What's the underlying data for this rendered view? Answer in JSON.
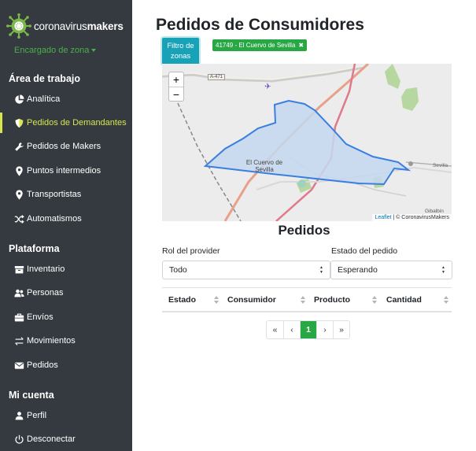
{
  "app": {
    "logo_prefix": "coronavirus",
    "logo_bold": "makers",
    "role_label": "Encargado de zona"
  },
  "sidebar": {
    "sections": [
      {
        "title": "Área de trabajo",
        "items": [
          {
            "label": "Analítica",
            "icon": "pie-chart-icon"
          },
          {
            "label": "Pedidos de Demandantes",
            "icon": "shield-icon",
            "active": true
          },
          {
            "label": "Pedidos de Makers",
            "icon": "wrench-icon"
          },
          {
            "label": "Puntos intermedios",
            "icon": "map-marker-icon"
          },
          {
            "label": "Transportistas",
            "icon": "map-marker-icon"
          },
          {
            "label": "Automatismos",
            "icon": "shuffle-icon"
          }
        ]
      },
      {
        "title": "Plataforma",
        "items": [
          {
            "label": "Inventario",
            "icon": "archive-icon"
          },
          {
            "label": "Personas",
            "icon": "users-icon"
          },
          {
            "label": "Envíos",
            "icon": "briefcase-icon"
          },
          {
            "label": "Movimientos",
            "icon": "exchange-icon"
          },
          {
            "label": "Pedidos",
            "icon": "envelope-icon"
          }
        ]
      },
      {
        "title": "Mi cuenta",
        "items": [
          {
            "label": "Perfil",
            "icon": "user-icon"
          },
          {
            "label": "Desconectar",
            "icon": "power-icon"
          }
        ]
      }
    ]
  },
  "main": {
    "title": "Pedidos de Consumidores",
    "filter_button": "Filtro de zonas",
    "filter_chip": "41749 - El Cuervo de Sevilla",
    "filter_chip_close": "✖",
    "map": {
      "zoom_in": "+",
      "zoom_out": "−",
      "town_label": "El Cuervo de Sevilla",
      "road_label": "A-471",
      "sevilla_label": "Sevilla",
      "gibalbin_label": "Gibalbin",
      "attribution_link": "Leaflet",
      "attribution_text": " | © CoronavirusMakers"
    },
    "orders_title": "Pedidos",
    "filters": {
      "provider_label": "Rol del provider",
      "provider_value": "Todo",
      "status_label": "Estado del pedido",
      "status_value": "Esperando"
    },
    "table": {
      "columns": [
        "Estado",
        "Consumidor",
        "Producto",
        "Cantidad"
      ],
      "rows": []
    },
    "pagination": {
      "first": "«",
      "prev": "‹",
      "current": "1",
      "next": "›",
      "last": "»"
    }
  },
  "colors": {
    "sidebar_bg": "#343a40",
    "active_accent": "#d7e64a",
    "primary_green": "#28a745",
    "info_teal": "#17a2b8",
    "zone_fill": "#c6d8f0",
    "zone_stroke": "#3a7fe0"
  }
}
